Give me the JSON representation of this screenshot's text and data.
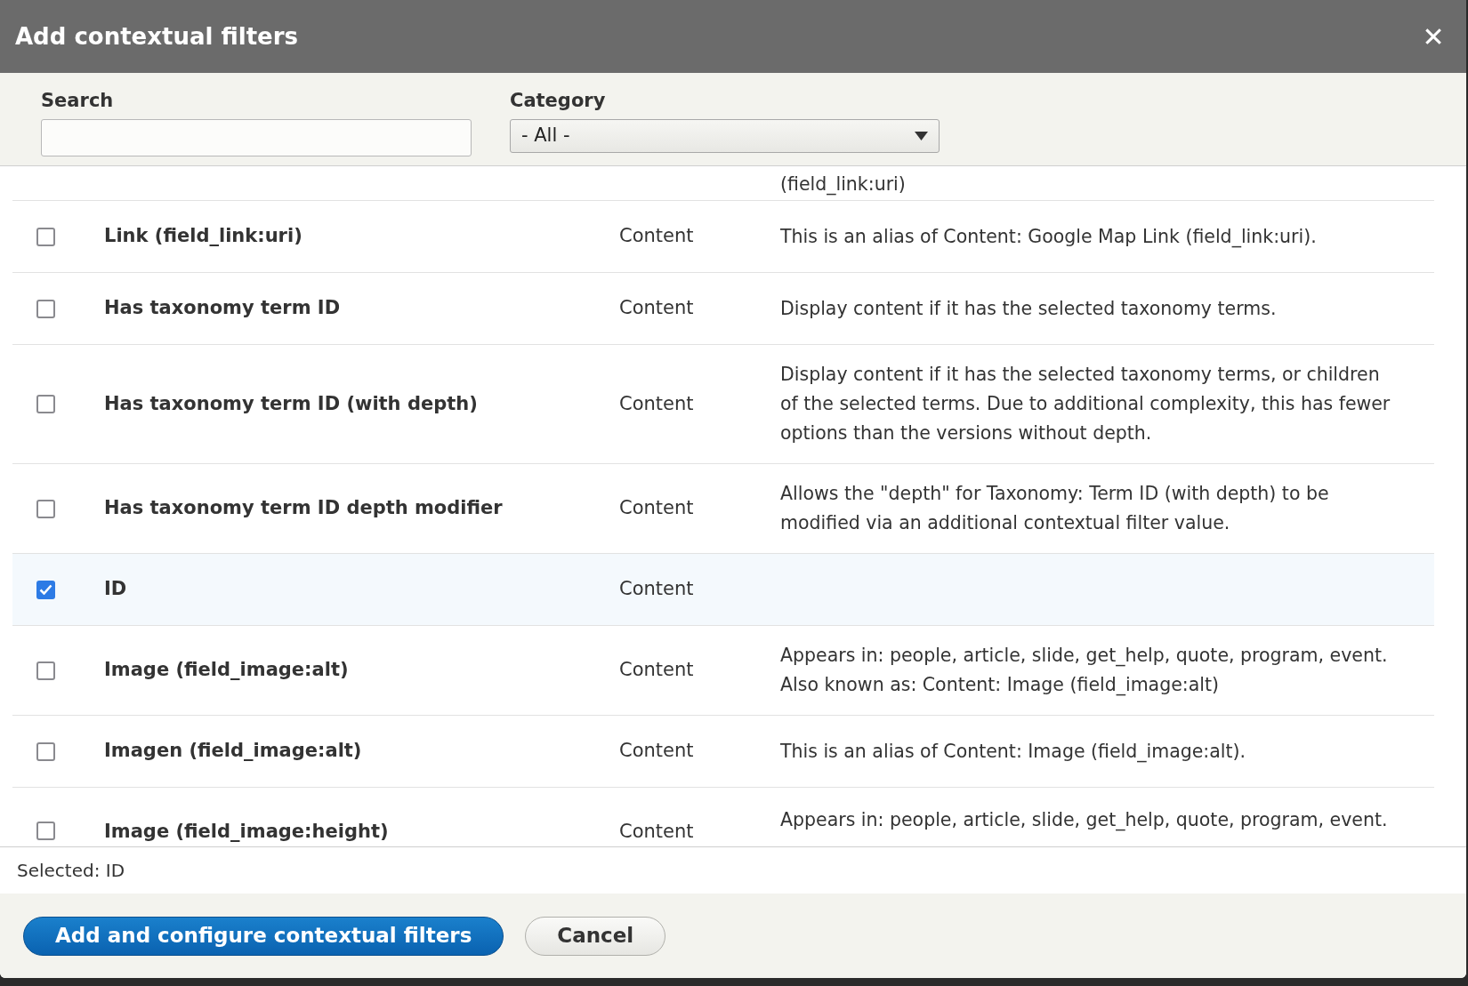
{
  "dialog": {
    "title": "Add contextual filters",
    "close": "✕"
  },
  "filters": {
    "search": {
      "label": "Search"
    },
    "category": {
      "label": "Category",
      "value": "- All -"
    }
  },
  "partial_row": {
    "description": "(field_link:uri)"
  },
  "rows": [
    {
      "name": "Link (field_link:uri)",
      "type": "Content",
      "description": [
        "This is an alias of Content: Google Map Link (field_link:uri)."
      ],
      "checked": false
    },
    {
      "name": "Has taxonomy term ID",
      "type": "Content",
      "description": [
        "Display content if it has the selected taxonomy terms."
      ],
      "checked": false
    },
    {
      "name": "Has taxonomy term ID (with depth)",
      "type": "Content",
      "description": [
        "Display content if it has the selected taxonomy terms, or children",
        "of the selected terms. Due to additional complexity, this has fewer",
        "options than the versions without depth."
      ],
      "checked": false
    },
    {
      "name": "Has taxonomy term ID depth modifier",
      "type": "Content",
      "description": [
        "Allows the \"depth\" for Taxonomy: Term ID (with depth) to be",
        "modified via an additional contextual filter value."
      ],
      "checked": false
    },
    {
      "name": "ID",
      "type": "Content",
      "description": [],
      "checked": true
    },
    {
      "name": "Image (field_image:alt)",
      "type": "Content",
      "description": [
        "Appears in: people, article, slide, get_help, quote, program, event.",
        "Also known as: Content: Image (field_image:alt)"
      ],
      "checked": false
    },
    {
      "name": "Imagen (field_image:alt)",
      "type": "Content",
      "description": [
        "This is an alias of Content: Image (field_image:alt)."
      ],
      "checked": false
    },
    {
      "name": "Image (field_image:height)",
      "type": "Content",
      "description": [
        "Appears in: people, article, slide, get_help, quote, program, event."
      ],
      "checked": false
    }
  ],
  "selected_summary": "Selected: ID",
  "buttons": [
    {
      "label": "Add and configure contextual filters",
      "kind": "primary"
    },
    {
      "label": "Cancel",
      "kind": "secondary"
    }
  ]
}
